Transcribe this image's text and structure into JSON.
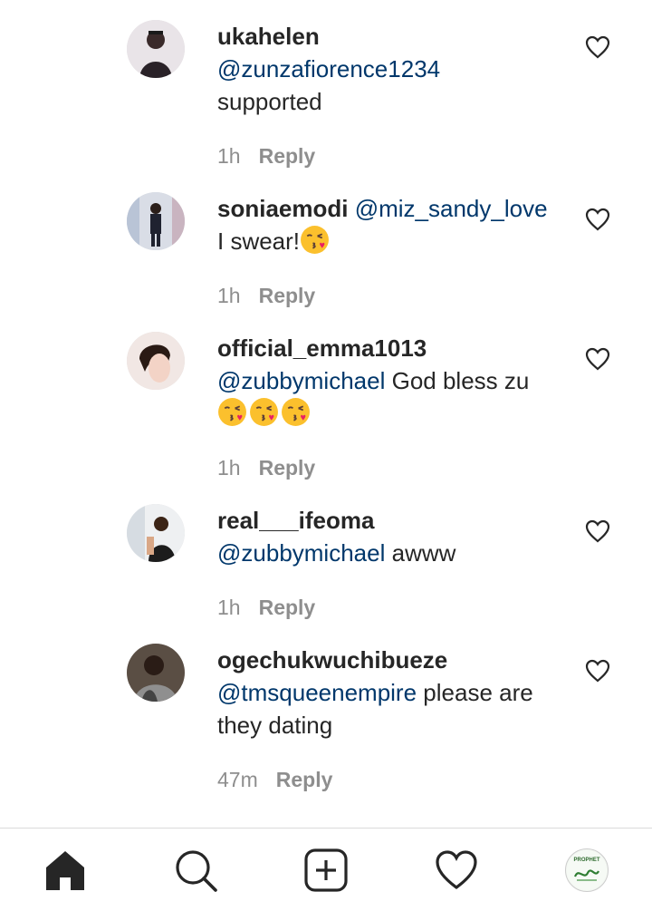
{
  "comments": [
    {
      "username": "ukahelen",
      "mention": "@zunzafiorence1234",
      "text": "supported",
      "time": "1h",
      "reply": "Reply"
    },
    {
      "username": "soniaemodi",
      "mention": "@miz_sandy_love",
      "text": "I swear!",
      "time": "1h",
      "reply": "Reply"
    },
    {
      "username": "official_emma1013",
      "mention": "@zubbymichael",
      "text": "God bless zu",
      "time": "1h",
      "reply": "Reply"
    },
    {
      "username": "real___ifeoma",
      "mention": "@zubbymichael",
      "text": "awww",
      "time": "1h",
      "reply": "Reply"
    },
    {
      "username": "ogechukwuchibueze",
      "mention": "@tmsqueenempire",
      "text": "please are they dating",
      "time": "47m",
      "reply": "Reply"
    }
  ],
  "icons": {
    "like": "heart-outline-icon",
    "emoji": "kissing-face-emoji",
    "nav_home": "home-icon",
    "nav_search": "search-icon",
    "nav_add": "add-post-icon",
    "nav_activity": "heart-icon",
    "nav_profile": "profile-avatar"
  },
  "profile_badge_text": "PROPHET",
  "colors": {
    "mention": "#00376b",
    "meta": "#8e8e8e",
    "text": "#262626",
    "divider": "#dbdbdb"
  }
}
